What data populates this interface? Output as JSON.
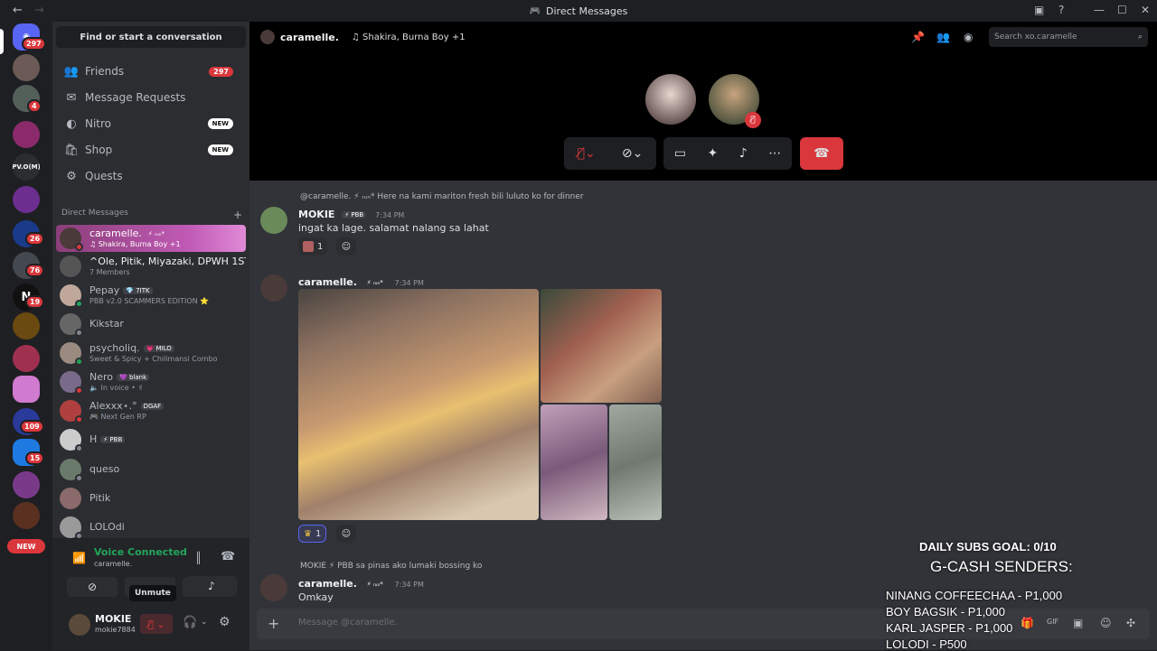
{
  "window": {
    "title": "Direct Messages"
  },
  "servers": {
    "home_badge": "297",
    "badges": [
      "4",
      "26",
      "76",
      "19",
      "109",
      "15"
    ],
    "pvo_label": "PV.O(M)",
    "new_label": "NEW"
  },
  "sidebar": {
    "search_label": "Find or start a conversation",
    "nav": [
      {
        "label": "Friends",
        "icon": "friends-icon",
        "badge": "297"
      },
      {
        "label": "Message Requests",
        "icon": "mail-icon"
      },
      {
        "label": "Nitro",
        "icon": "nitro-icon",
        "badge": "NEW"
      },
      {
        "label": "Shop",
        "icon": "shop-icon",
        "badge": "NEW"
      },
      {
        "label": "Quests",
        "icon": "quests-icon"
      }
    ],
    "dm_header": "Direct Messages",
    "dms": [
      {
        "name": "caramelle.",
        "tag": "⚡ ᵣᵤₙ*",
        "sub": "♫ Shakira, Burna Boy +1"
      },
      {
        "name": "^Ole, Pitik, Miyazaki, DPWH 1ST...",
        "sub": "7 Members"
      },
      {
        "name": "Pepay",
        "tag": "💎 7ITK",
        "sub": "PBB v2.0 SCAMMERS EDITION ⭐"
      },
      {
        "name": "Kikstar",
        "sub": ""
      },
      {
        "name": "psycholiq.",
        "tag": "💗 MILO",
        "sub": "Sweet & Spicy + Chilimansi Combo"
      },
      {
        "name": "Nero",
        "tag": "💜 blank",
        "sub": "🔈 In voice • ✌"
      },
      {
        "name": "Alexxx⋆.°",
        "tag": "DGAF",
        "sub": "🎮 Next Gen RP"
      },
      {
        "name": "H",
        "tag": "⚡ PBB",
        "sub": ""
      },
      {
        "name": "queso",
        "sub": ""
      },
      {
        "name": "Pitik",
        "sub": ""
      },
      {
        "name": "LOLOdi",
        "sub": ""
      }
    ]
  },
  "voice": {
    "status": "Voice Connected",
    "channel": "caramelle.",
    "tooltip": "Unmute"
  },
  "user": {
    "name": "MOKIE",
    "handle": "mokie7884"
  },
  "topbar": {
    "name": "caramelle.",
    "activity": "♫ Shakira, Burna Boy +1",
    "search_placeholder": "Search xo.caramelle"
  },
  "messages": [
    {
      "reply": "@caramelle. ⚡ ᵣᵤₙ* Here na kami mariton fresh bili luluto ko for dinner",
      "author": "MOKIE",
      "tag": "⚡ PBB",
      "time": "7:34 PM",
      "text": "ingat ka lage. salamat nalang sa lahat",
      "reaction_count": "1"
    },
    {
      "author": "caramelle.",
      "tag": "⚡ ᵣᵤₙ*",
      "time": "7:34 PM",
      "reaction_count": "1"
    },
    {
      "reply": "MOKIE ⚡ PBB sa pinas ako lumaki bossing ko",
      "author": "caramelle.",
      "tag": "⚡ ᵣᵤₙ*",
      "time": "7:34 PM",
      "text": "Omkay"
    }
  ],
  "input": {
    "placeholder": "Message @caramelle."
  },
  "overlay": {
    "goal": "DAILY SUBS GOAL: 0/10",
    "heading": "G-CASH SENDERS:",
    "senders": [
      "NINANG COFFEECHAA - P1,000",
      "BOY BAGSIK - P1,000",
      "KARL JASPER - P1,000",
      "LOLODI - P500"
    ]
  }
}
